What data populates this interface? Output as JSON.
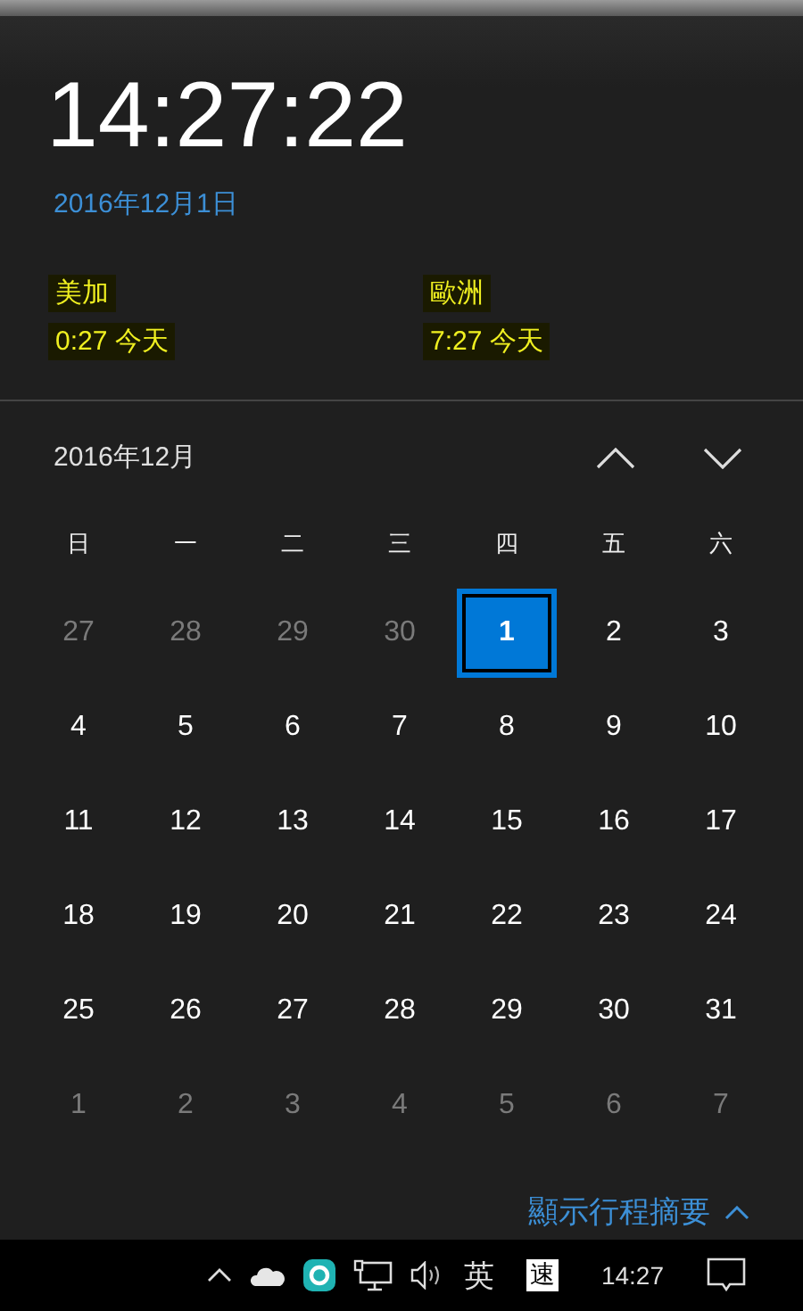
{
  "clock": {
    "time": "14:27:22",
    "date": "2016年12月1日"
  },
  "zones": [
    {
      "name": "美加",
      "time": "0:27 今天"
    },
    {
      "name": "歐洲",
      "time": "7:27 今天"
    }
  ],
  "calendar": {
    "month": "2016年12月",
    "weekdays": [
      "日",
      "一",
      "二",
      "三",
      "四",
      "五",
      "六"
    ],
    "days": [
      {
        "day": "27",
        "muted": true,
        "selected": false
      },
      {
        "day": "28",
        "muted": true,
        "selected": false
      },
      {
        "day": "29",
        "muted": true,
        "selected": false
      },
      {
        "day": "30",
        "muted": true,
        "selected": false
      },
      {
        "day": "1",
        "muted": false,
        "selected": true
      },
      {
        "day": "2",
        "muted": false,
        "selected": false
      },
      {
        "day": "3",
        "muted": false,
        "selected": false
      },
      {
        "day": "4",
        "muted": false,
        "selected": false
      },
      {
        "day": "5",
        "muted": false,
        "selected": false
      },
      {
        "day": "6",
        "muted": false,
        "selected": false
      },
      {
        "day": "7",
        "muted": false,
        "selected": false
      },
      {
        "day": "8",
        "muted": false,
        "selected": false
      },
      {
        "day": "9",
        "muted": false,
        "selected": false
      },
      {
        "day": "10",
        "muted": false,
        "selected": false
      },
      {
        "day": "11",
        "muted": false,
        "selected": false
      },
      {
        "day": "12",
        "muted": false,
        "selected": false
      },
      {
        "day": "13",
        "muted": false,
        "selected": false
      },
      {
        "day": "14",
        "muted": false,
        "selected": false
      },
      {
        "day": "15",
        "muted": false,
        "selected": false
      },
      {
        "day": "16",
        "muted": false,
        "selected": false
      },
      {
        "day": "17",
        "muted": false,
        "selected": false
      },
      {
        "day": "18",
        "muted": false,
        "selected": false
      },
      {
        "day": "19",
        "muted": false,
        "selected": false
      },
      {
        "day": "20",
        "muted": false,
        "selected": false
      },
      {
        "day": "21",
        "muted": false,
        "selected": false
      },
      {
        "day": "22",
        "muted": false,
        "selected": false
      },
      {
        "day": "23",
        "muted": false,
        "selected": false
      },
      {
        "day": "24",
        "muted": false,
        "selected": false
      },
      {
        "day": "25",
        "muted": false,
        "selected": false
      },
      {
        "day": "26",
        "muted": false,
        "selected": false
      },
      {
        "day": "27",
        "muted": false,
        "selected": false
      },
      {
        "day": "28",
        "muted": false,
        "selected": false
      },
      {
        "day": "29",
        "muted": false,
        "selected": false
      },
      {
        "day": "30",
        "muted": false,
        "selected": false
      },
      {
        "day": "31",
        "muted": false,
        "selected": false
      },
      {
        "day": "1",
        "muted": true,
        "selected": false
      },
      {
        "day": "2",
        "muted": true,
        "selected": false
      },
      {
        "day": "3",
        "muted": true,
        "selected": false
      },
      {
        "day": "4",
        "muted": true,
        "selected": false
      },
      {
        "day": "5",
        "muted": true,
        "selected": false
      },
      {
        "day": "6",
        "muted": true,
        "selected": false
      },
      {
        "day": "7",
        "muted": true,
        "selected": false
      }
    ]
  },
  "agenda_link": "顯示行程摘要",
  "taskbar": {
    "input_mode": "英",
    "ime": "速",
    "time": "14:27"
  }
}
